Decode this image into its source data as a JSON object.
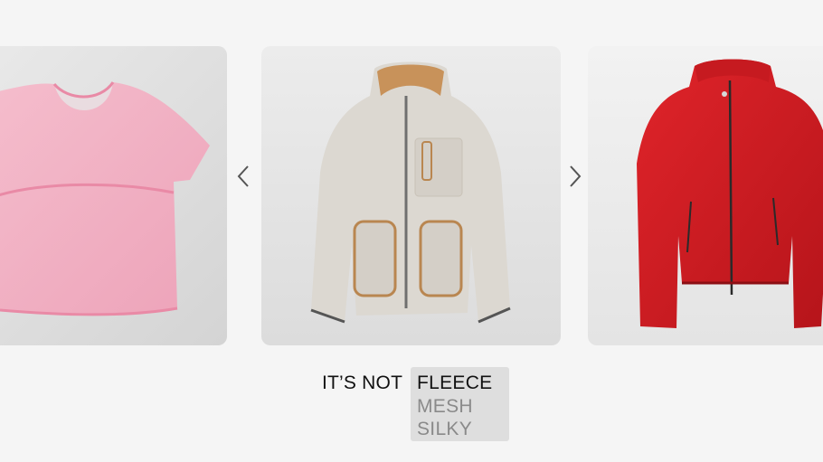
{
  "carousel": {
    "items": [
      {
        "name": "pink mesh t-shirt",
        "icon": "pink-mesh-shirt-image"
      },
      {
        "name": "cream fleece jacket",
        "icon": "fleece-jacket-image"
      },
      {
        "name": "red leather jacket",
        "icon": "leather-jacket-image"
      }
    ],
    "prev_icon": "chevron-left-icon",
    "next_icon": "chevron-right-icon"
  },
  "caption": {
    "prefix": "IT’S NOT",
    "options": [
      "FLEECE",
      "MESH",
      "SILKY"
    ],
    "selected_index": 0
  },
  "colors": {
    "background": "#f5f5f5",
    "selected_text": "#111111",
    "unselected_text": "#8a8a8a",
    "option_box": "#dedede"
  }
}
